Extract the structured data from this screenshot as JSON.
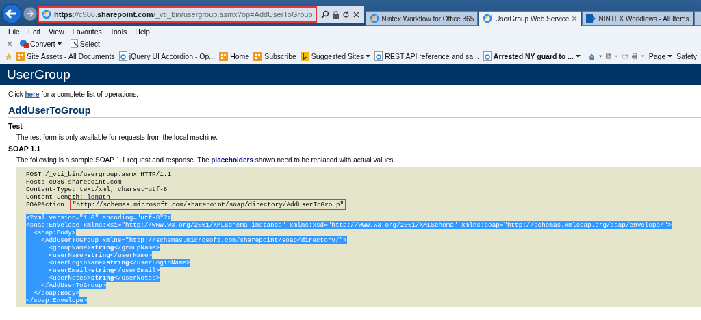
{
  "browser": {
    "address": {
      "url": "**https**://c986.**sharepoint.com**/_vti_bin/usergroup.asmx?op=AddUserToGroup",
      "highlighted": true
    },
    "tabs": [
      {
        "label": "Nintex Workflow for Office 365",
        "kind": "ie",
        "selected": false
      },
      {
        "label": "UserGroup Web Service",
        "kind": "ie",
        "selected": true
      },
      {
        "label": "NINTEX Workflows - All Items",
        "kind": "sp",
        "selected": false
      }
    ],
    "menu": [
      "File",
      "Edit",
      "View",
      "Favorites",
      "Tools",
      "Help"
    ],
    "command_bar": [
      {
        "label": "Convert",
        "kind": "convert"
      },
      {
        "label": "Select",
        "kind": "select"
      }
    ],
    "favorites": [
      {
        "label": "Site Assets - All Documents",
        "kind": "sp",
        "bold": false,
        "dropdown": false
      },
      {
        "label": "jQuery UI Accordion - Op...",
        "kind": "page",
        "bold": false,
        "dropdown": false
      },
      {
        "label": "Home",
        "kind": "sp",
        "bold": false,
        "dropdown": false
      },
      {
        "label": "Subscribe",
        "kind": "sp",
        "bold": false,
        "dropdown": false
      },
      {
        "label": "Suggested Sites",
        "kind": "bing",
        "bold": false,
        "dropdown": true
      },
      {
        "label": "REST API reference and sa...",
        "kind": "page",
        "bold": false,
        "dropdown": false
      },
      {
        "label": "Arrested NY guard to ...",
        "kind": "page",
        "bold": true,
        "dropdown": true
      }
    ],
    "right_tools": [
      {
        "label": "Page"
      },
      {
        "label": "Safety"
      }
    ]
  },
  "page": {
    "title": "UserGroup",
    "intro": {
      "before": "Click ",
      "link": "here",
      "after": " for a complete list of operations."
    },
    "operation": "AddUserToGroup",
    "sections": [
      {
        "heading": "Test",
        "text": "The test form is only available for requests from the local machine."
      },
      {
        "heading": "SOAP 1.1",
        "text": "The following is a sample SOAP 1.1 request and response. The **placeholders** shown need to be replaced with actual values."
      }
    ],
    "code": {
      "headers": [
        {
          "text": "POST /_vti_bin/usergroup.asmx HTTP/1.1",
          "kind": "plain"
        },
        {
          "text": "Host: c986.sharepoint.com",
          "kind": "plain"
        },
        {
          "text": "Content-Type: text/xml; charset=utf-8",
          "kind": "plain"
        },
        {
          "text": "Content-Length: ",
          "value": "length",
          "kind": "placeholder"
        },
        {
          "text": "SOAPAction: ",
          "value": "\"http://schemas.microsoft.com/sharepoint/soap/directory/AddUserToGroup\"",
          "kind": "boxed"
        }
      ],
      "xml_selected": true,
      "xml": [
        "<?xml version=\"1.0\" encoding=\"utf-8\"?>",
        "<soap:Envelope xmlns:xsi=\"http://www.w3.org/2001/XMLSchema-instance\" xmlns:xsd=\"http://www.w3.org/2001/XMLSchema\" xmlns:soap=\"http://schemas.xmlsoap.org/soap/envelope/\">",
        "  <soap:Body>",
        "    <AddUserToGroup xmlns=\"http://schemas.microsoft.com/sharepoint/soap/directory/\">",
        "      <groupName>**string**</groupName>",
        "      <userName>**string**</userName>",
        "      <userLoginName>**string**</userLoginName>",
        "      <userEmail>**string**</userEmail>",
        "      <userNotes>**string**</userNotes>",
        "    </AddUserToGroup>",
        "  </soap:Body>",
        "</soap:Envelope>"
      ]
    }
  }
}
